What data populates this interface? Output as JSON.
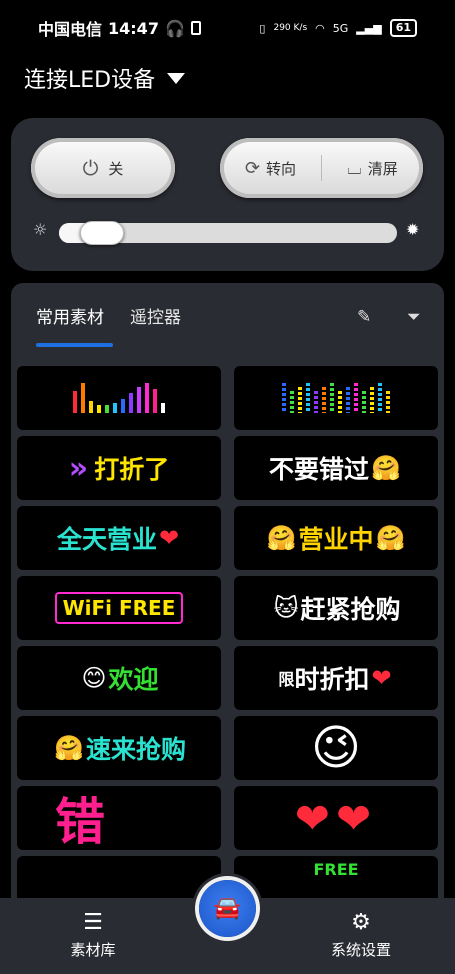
{
  "status_bar": {
    "carrier": "中国电信",
    "time": "14:47",
    "speed": "290 K/s",
    "network": "5G",
    "battery": "61"
  },
  "header": {
    "title": "连接LED设备"
  },
  "controls": {
    "power_label": "关",
    "rotate_label": "转向",
    "clear_label": "清屏",
    "brightness_percent": 7
  },
  "tabs": [
    {
      "label": "常用素材",
      "active": true
    },
    {
      "label": "遥控器",
      "active": false
    }
  ],
  "tiles": [
    {
      "id": "equalizer-a",
      "type": "bars"
    },
    {
      "id": "equalizer-b",
      "type": "bars"
    },
    {
      "id": "discount",
      "prefix": "»",
      "text": "打折了",
      "color": "#ffe600"
    },
    {
      "id": "dont-miss",
      "text": "不要错过",
      "emoji": "🤗",
      "color": "#ffffff"
    },
    {
      "id": "open-all-day",
      "text": "全天营业",
      "emoji": "❤",
      "color": "#29e3d0"
    },
    {
      "id": "open-now",
      "text": "营业中",
      "emoji": "🤗",
      "color": "#ffd400"
    },
    {
      "id": "free-wifi",
      "text": "WiFi FREE",
      "color": "#ffe600"
    },
    {
      "id": "buy-now",
      "text": "赶紧抢购",
      "emoji": "🐱",
      "color": "#ffffff"
    },
    {
      "id": "welcome",
      "text": "欢迎",
      "emoji": "😊",
      "color": "#33e033"
    },
    {
      "id": "discount-time",
      "text": "时折扣",
      "prefix": "限",
      "emoji": "❤",
      "color": "#ffffff"
    },
    {
      "id": "come-grab",
      "text": "速来抢购",
      "emoji": "🤗",
      "color": "#29e3d0"
    },
    {
      "id": "wink-face",
      "emoji": "😉"
    },
    {
      "id": "wrong",
      "text": "错",
      "color": "#ff1f8e"
    },
    {
      "id": "hearts",
      "emoji": "❤❤"
    },
    {
      "id": "partial-a",
      "text": ""
    },
    {
      "id": "partial-b",
      "text": "FREE"
    }
  ],
  "bottom_nav": {
    "library_label": "素材库",
    "settings_label": "系统设置"
  },
  "colors": {
    "panel": "#2a2c33",
    "accent": "#1e6fe0"
  }
}
